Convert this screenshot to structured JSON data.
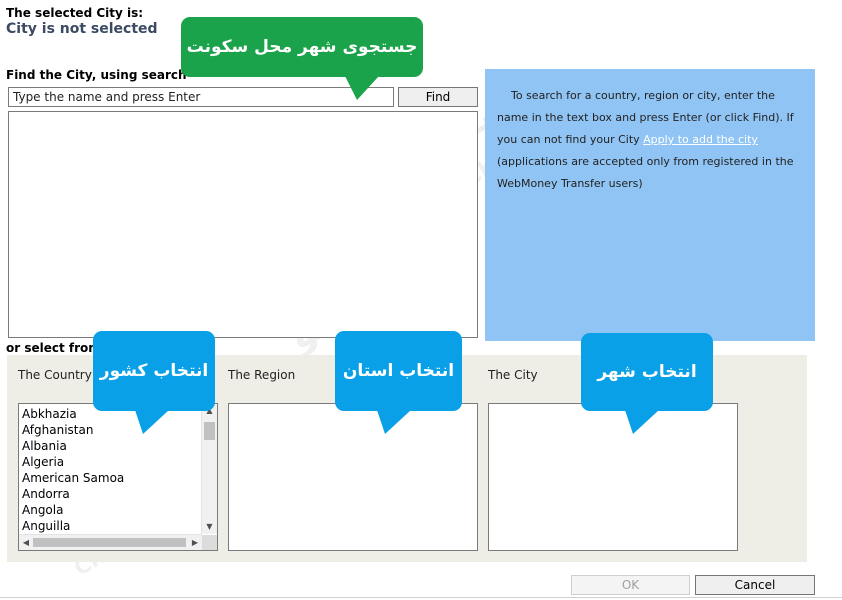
{
  "selected": {
    "label": "The selected City is:",
    "value": "City is not selected"
  },
  "search": {
    "label": "Find the City, using search",
    "value": "Type the name and press Enter",
    "find_label": "Find"
  },
  "info": {
    "line1": "To search for a country, region or city, enter the name in the text box and press Enter (or click Find). If you can not find your City",
    "link": "Apply to add the city",
    "line2": "(applications are accepted only from registered in the WebMoney Transfer users)"
  },
  "select": {
    "label": "or select from",
    "country_label": "The Country",
    "region_label": "The Region",
    "city_label": "The City",
    "countries": [
      "Abkhazia",
      "Afghanistan",
      "Albania",
      "Algeria",
      "American Samoa",
      "Andorra",
      "Angola",
      "Anguilla"
    ]
  },
  "footer": {
    "ok_label": "OK",
    "cancel_label": "Cancel"
  },
  "callouts": {
    "search_city": "جستجوی شهر محل سکونت",
    "country": "انتخاب کشور",
    "region": "انتخاب استان",
    "city": "انتخاب شهر"
  },
  "watermark": {
    "text_fa": "چنجینو",
    "text_en": "Changino.com"
  },
  "colors": {
    "info_bg": "#90c4f4",
    "callout_green": "#1aa34a",
    "callout_blue": "#0aa0e8",
    "panel_bg": "#eeede6"
  }
}
